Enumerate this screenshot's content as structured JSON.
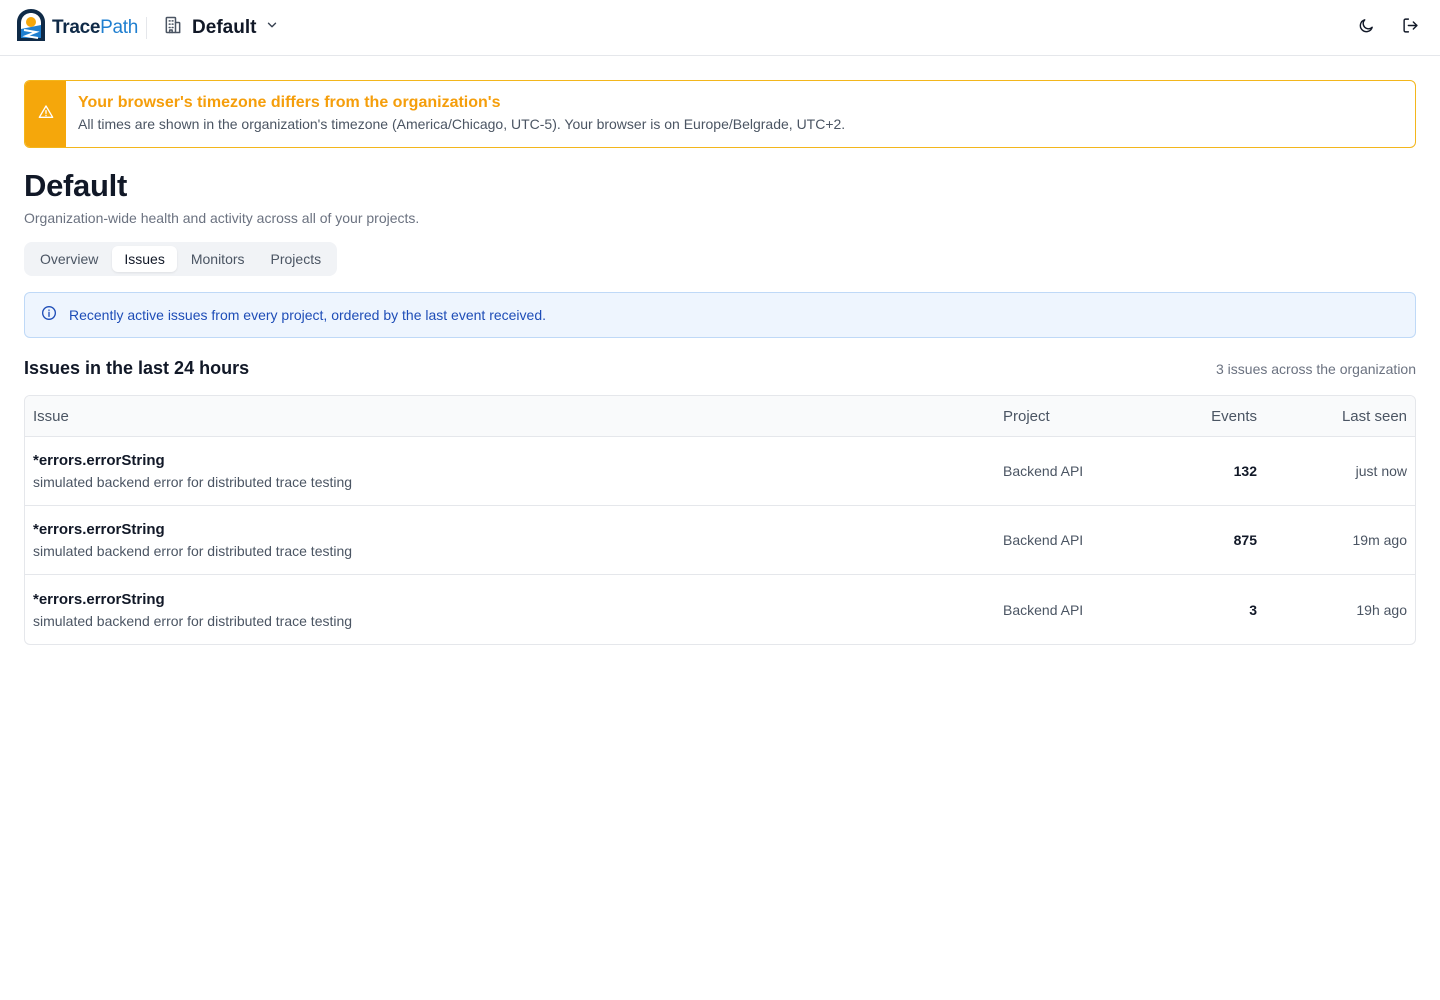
{
  "header": {
    "brand_part1": "Trace",
    "brand_part2": "Path",
    "org_name": "Default",
    "icons": [
      "logo-icon",
      "building-icon",
      "chevron-down-icon",
      "moon-icon",
      "logout-icon"
    ]
  },
  "warning": {
    "title": "Your browser's timezone differs from the organization's",
    "text": "All times are shown in the organization's timezone (America/Chicago, UTC-5). Your browser is on Europe/Belgrade, UTC+2.",
    "icon": "warning-triangle-icon",
    "color": "#f5a70b"
  },
  "page": {
    "title": "Default",
    "subtitle": "Organization-wide health and activity across all of your projects."
  },
  "tabs": [
    {
      "label": "Overview",
      "active": false
    },
    {
      "label": "Issues",
      "active": true
    },
    {
      "label": "Monitors",
      "active": false
    },
    {
      "label": "Projects",
      "active": false
    }
  ],
  "info": {
    "text": "Recently active issues from every project, ordered by the last event received.",
    "icon": "info-circle-icon"
  },
  "issues_section": {
    "title": "Issues in the last 24 hours",
    "meta": "3 issues across the organization"
  },
  "table": {
    "columns": {
      "issue": "Issue",
      "project": "Project",
      "events": "Events",
      "last_seen": "Last seen"
    },
    "rows": [
      {
        "title": "*errors.errorString",
        "message": "simulated backend error for distributed trace testing",
        "project": "Backend API",
        "events": "132",
        "last_seen": "just now"
      },
      {
        "title": "*errors.errorString",
        "message": "simulated backend error for distributed trace testing",
        "project": "Backend API",
        "events": "875",
        "last_seen": "19m ago"
      },
      {
        "title": "*errors.errorString",
        "message": "simulated backend error for distributed trace testing",
        "project": "Backend API",
        "events": "3",
        "last_seen": "19h ago"
      }
    ]
  }
}
